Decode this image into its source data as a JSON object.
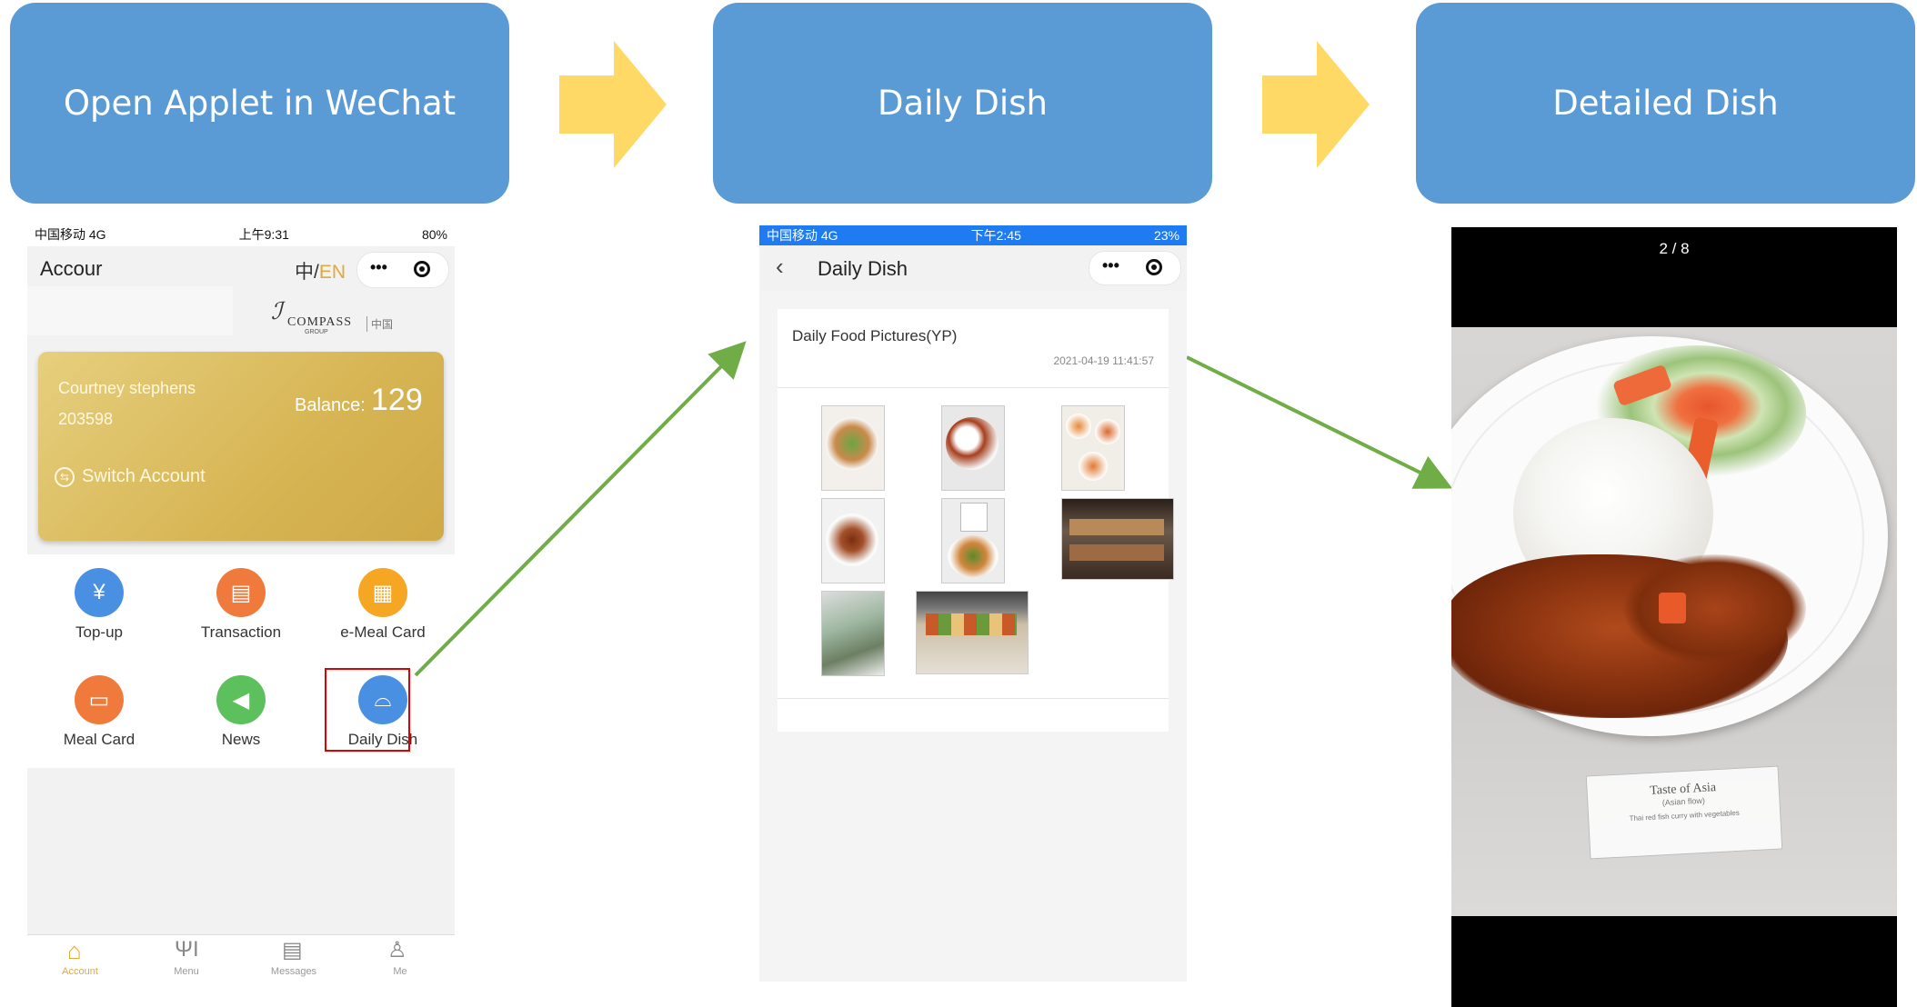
{
  "steps": [
    {
      "label": "Open Applet in WeChat"
    },
    {
      "label": "Daily Dish"
    },
    {
      "label": "Detailed Dish"
    }
  ],
  "colors": {
    "step_bg": "#5b9bd5",
    "arrow": "#ffd966",
    "connector": "#70ad47",
    "highlight": "#e00000"
  },
  "phone1": {
    "status": {
      "carrier": "中国移动 4G",
      "time": "上午9:31",
      "battery": "80%"
    },
    "header": {
      "title": "Accour",
      "lang_zh": "中",
      "lang_sep": "/",
      "lang_en": "EN",
      "more": "•••"
    },
    "logo": {
      "brand": "COMPASS",
      "sub": "GROUP",
      "cn": "中国"
    },
    "card": {
      "name": "Courtney stephens",
      "id": "203598",
      "balance_label": "Balance:",
      "balance": "129",
      "switch": "Switch Account"
    },
    "grid": [
      {
        "label": "Top-up",
        "icon": "yen-icon",
        "color": "#4a90e2"
      },
      {
        "label": "Transaction",
        "icon": "receipt-icon",
        "color": "#f07a3c"
      },
      {
        "label": "e-Meal Card",
        "icon": "qr-icon",
        "color": "#f5a623"
      },
      {
        "label": "Meal Card",
        "icon": "card-icon",
        "color": "#f07a3c"
      },
      {
        "label": "News",
        "icon": "speaker-icon",
        "color": "#5cc05c"
      },
      {
        "label": "Daily Dish",
        "icon": "cloche-icon",
        "color": "#4a90e2"
      }
    ],
    "tabs": [
      {
        "label": "Account",
        "icon": "home-icon"
      },
      {
        "label": "Menu",
        "icon": "cutlery-icon"
      },
      {
        "label": "Messages",
        "icon": "clipboard-icon"
      },
      {
        "label": "Me",
        "icon": "person-icon"
      }
    ]
  },
  "phone2": {
    "status": {
      "carrier": "中国移动 4G",
      "time": "下午2:45",
      "battery": "23%"
    },
    "header": {
      "title": "Daily Dish",
      "more": "•••"
    },
    "post": {
      "title": "Daily Food Pictures(YP)",
      "timestamp": "2021-04-19 11:41:57"
    }
  },
  "phone3": {
    "counter": "2 / 8",
    "sign_title": "Taste of Asia",
    "sign_sub": "(Asian flow)",
    "sign_desc": "Thai red fish curry with vegetables"
  }
}
